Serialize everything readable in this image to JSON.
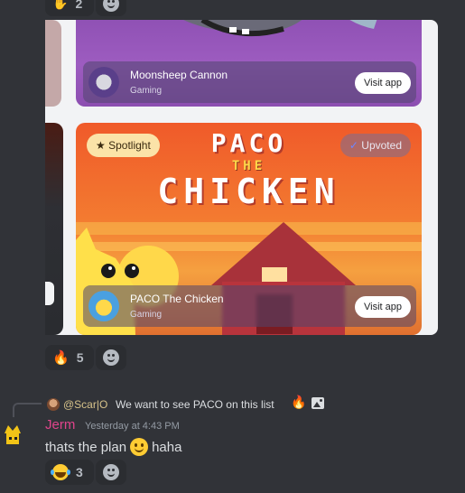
{
  "top_reaction": {
    "count": "2"
  },
  "embed": {
    "moonsheep": {
      "name": "Moonsheep Cannon",
      "category": "Gaming",
      "visit": "Visit app"
    },
    "paco": {
      "name": "PACO The Chicken",
      "category": "Gaming",
      "visit": "Visit app",
      "spotlight": "Spotlight",
      "upvoted": "Upvoted",
      "title_line1": "PACO",
      "title_line2": "THE",
      "title_line3": "CHICKEN"
    }
  },
  "reactions1": {
    "fire_count": "5"
  },
  "reply": {
    "author": "@Scar|O",
    "text": "We want to see PACO on this list"
  },
  "message": {
    "author": "Jerm",
    "timestamp": "Yesterday at 4:43 PM",
    "text_before": "thats the plan",
    "text_after": "haha",
    "author_color": "#e0448c"
  },
  "reactions2": {
    "laugh_count": "3"
  }
}
